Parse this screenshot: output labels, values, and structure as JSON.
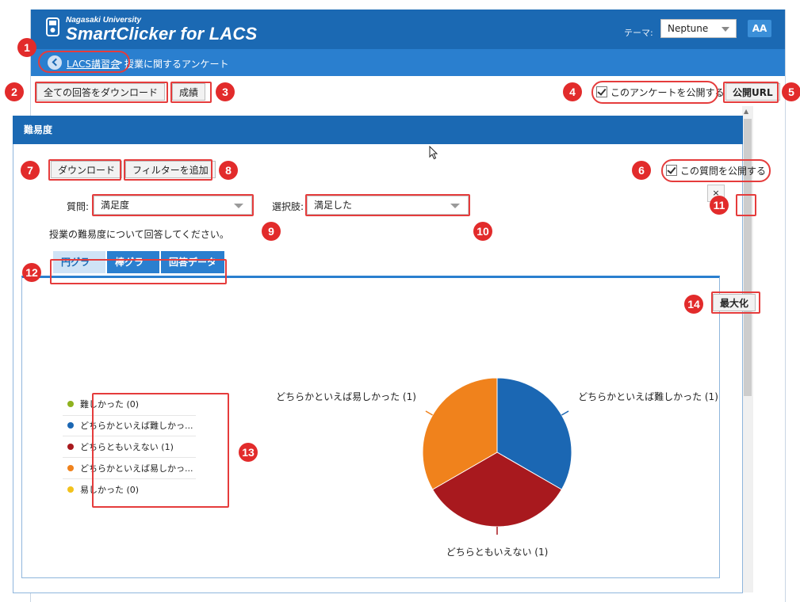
{
  "header": {
    "brand_sub": "Nagasaki University",
    "brand_main": "SmartClicker for LACS",
    "theme_label": "テーマ:",
    "theme_value": "Neptune",
    "font_button": "AA"
  },
  "breadcrumb": {
    "parent": "LACS講習会",
    "separator": ">",
    "current": "授業に関するアンケート"
  },
  "toolbar": {
    "download_all": "全ての回答をダウンロード",
    "grades": "成績",
    "publish_survey": "このアンケートを公開する",
    "public_url": "公開URL"
  },
  "panel": {
    "title": "難易度",
    "download": "ダウンロード",
    "add_filter": "フィルターを追加",
    "publish_question": "この質問を公開する",
    "question_label": "質問:",
    "question_value": "満足度",
    "choice_label": "選択肢:",
    "choice_value": "満足した",
    "remove": "×",
    "description": "授業の難易度について回答してください。",
    "maximize": "最大化"
  },
  "tabs": [
    {
      "label": "円グラフ",
      "active": true
    },
    {
      "label": "棒グラフ",
      "active": false
    },
    {
      "label": "回答データ",
      "active": false
    }
  ],
  "callouts": [
    "1",
    "2",
    "3",
    "4",
    "5",
    "6",
    "7",
    "8",
    "9",
    "10",
    "11",
    "12",
    "13",
    "14"
  ],
  "chart_data": {
    "type": "pie",
    "slices": [
      {
        "label": "難しかった",
        "value": 0,
        "legend": "難しかった (0)",
        "color": "#8fb21f"
      },
      {
        "label": "どちらかといえば難しかった",
        "value": 1,
        "legend": "どちらかといえば難しかっ...",
        "slice_label": "どちらかといえば難しかった (1)",
        "color": "#1b67b3"
      },
      {
        "label": "どちらともいえない",
        "value": 1,
        "legend": "どちらともいえない (1)",
        "slice_label": "どちらともいえない (1)",
        "color": "#a8191e"
      },
      {
        "label": "どちらかといえば易しかった",
        "value": 1,
        "legend": "どちらかといえば易しかっ...",
        "slice_label": "どちらかといえば易しかった (1)",
        "color": "#f0821c"
      },
      {
        "label": "易しかった",
        "value": 0,
        "legend": "易しかった (0)",
        "color": "#f2c21c"
      }
    ],
    "legend_position": "left"
  }
}
